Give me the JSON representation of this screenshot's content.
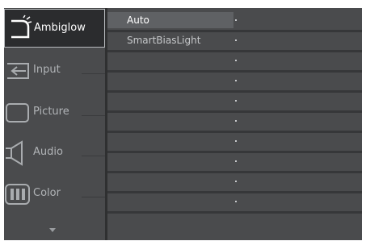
{
  "menu": {
    "items": [
      {
        "label": "Ambiglow",
        "icon": "ambiglow-icon",
        "active": true
      },
      {
        "label": "Input",
        "icon": "input-icon",
        "active": false
      },
      {
        "label": "Picture",
        "icon": "picture-icon",
        "active": false
      },
      {
        "label": "Audio",
        "icon": "audio-icon",
        "active": false
      },
      {
        "label": "Color",
        "icon": "color-icon",
        "active": false
      }
    ],
    "scroll_indicator": "chevron-down-icon"
  },
  "submenu": {
    "options": [
      {
        "label": "Auto",
        "selected": true
      },
      {
        "label": "SmartBiasLight",
        "selected": false
      },
      {
        "label": "",
        "selected": false
      },
      {
        "label": "",
        "selected": false
      },
      {
        "label": "",
        "selected": false
      },
      {
        "label": "",
        "selected": false
      },
      {
        "label": "",
        "selected": false
      },
      {
        "label": "",
        "selected": false
      },
      {
        "label": "",
        "selected": false
      },
      {
        "label": "",
        "selected": false
      }
    ]
  },
  "colors": {
    "panel_bg": "#4a4b4d",
    "active_item_bg": "#2b2c2e",
    "active_border": "#b9bcbf",
    "selected_option_bg": "#5f6164",
    "text_active": "#ffffff",
    "text_inactive": "#b0b3b6"
  }
}
